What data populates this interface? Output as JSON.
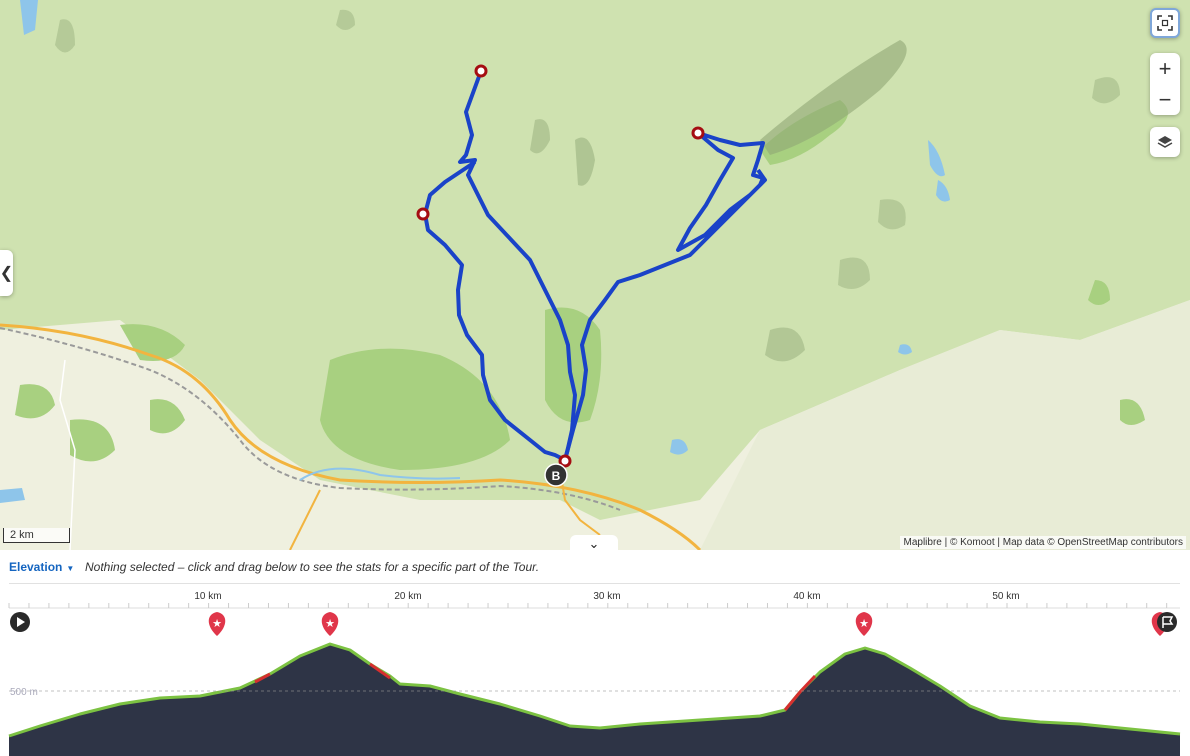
{
  "map": {
    "scale_label": "2 km",
    "attribution": "Maplibre | © Komoot | Map data © OpenStreetMap contributors",
    "controls": {
      "fullscreen_icon": "fullscreen-icon",
      "zoom_in_label": "+",
      "zoom_out_label": "−",
      "layers_icon": "layers-icon",
      "collapse_icon": "chevron-left-icon",
      "expand_icon": "chevron-down-icon"
    },
    "markers": {
      "end_label": "B"
    },
    "colors": {
      "route": "#1a43c8",
      "waypoint": "#a50d12",
      "land": "#cfe2b0",
      "forest": "#a8d080",
      "lowland": "#eff0df"
    }
  },
  "elevation_panel": {
    "selector_label": "Elevation",
    "hint": "Nothing selected – click and drag below to see the stats for a specific part of the Tour.",
    "x_ticks": [
      "10 km",
      "20 km",
      "30 km",
      "40 km",
      "50 km"
    ],
    "y_label": "500 m",
    "highlight_icons": [
      "play-icon",
      "star-marker-icon",
      "star-marker-icon",
      "star-marker-icon",
      "finish-flag-icon"
    ],
    "colors": {
      "profile_fill": "#2e3446",
      "profile_edge": "#7cc242",
      "steep": "#d62f2f",
      "marker": "#e0364a"
    }
  }
}
